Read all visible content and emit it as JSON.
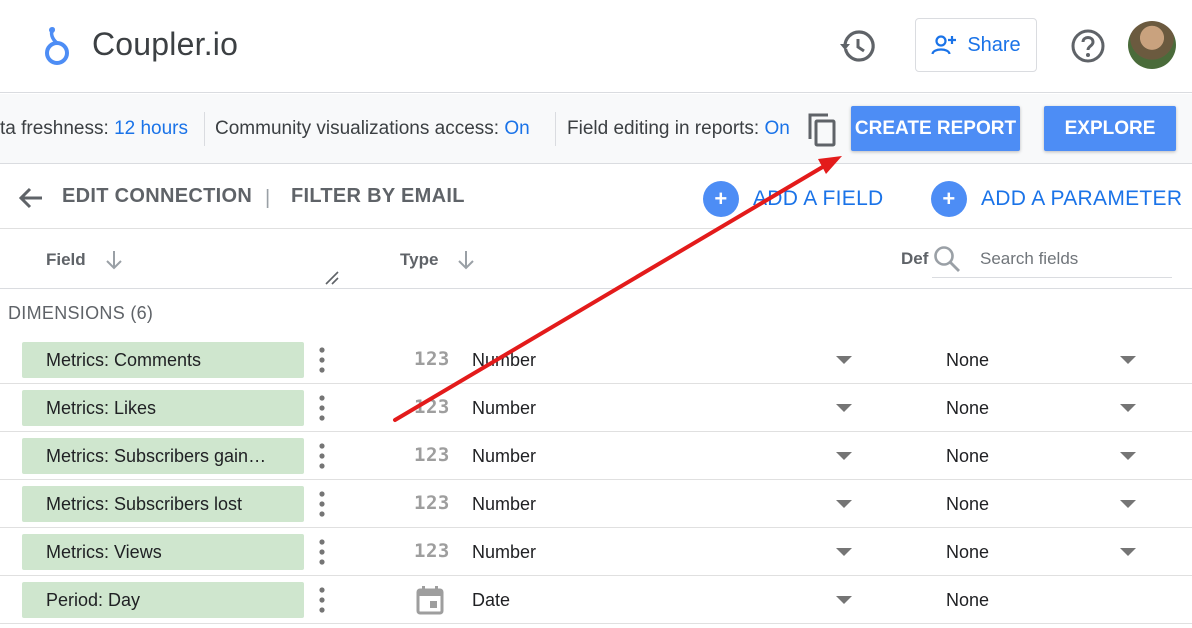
{
  "header": {
    "app_title": "Coupler.io",
    "share_label": "Share",
    "icons": {
      "logo": "coupler-logo",
      "history": "history-icon",
      "share": "person-add-icon",
      "help": "help-circle-icon",
      "avatar": "user-avatar"
    }
  },
  "infobar": {
    "freshness_label": "ta freshness: ",
    "freshness_value": "12 hours",
    "community_label": "Community visualizations access: ",
    "community_value": "On",
    "editing_label": "Field editing in reports: ",
    "editing_value": "On",
    "create_report_label": "CREATE REPORT",
    "explore_label": "EXPLORE"
  },
  "toolbar": {
    "edit_connection": "EDIT CONNECTION",
    "separator": "|",
    "filter_by_email": "FILTER BY EMAIL",
    "add_field": "ADD A FIELD",
    "add_parameter": "ADD A PARAMETER",
    "plus": "+"
  },
  "table": {
    "col_field": "Field",
    "col_type": "Type",
    "col_default": "Def",
    "search_placeholder": "Search fields",
    "section_title": "DIMENSIONS (6)",
    "rows": [
      {
        "name": "Metrics: Comments",
        "type_icon": "123",
        "type": "Number",
        "aggregation": "None"
      },
      {
        "name": "Metrics: Likes",
        "type_icon": "123",
        "type": "Number",
        "aggregation": "None"
      },
      {
        "name": "Metrics: Subscribers gain…",
        "type_icon": "123",
        "type": "Number",
        "aggregation": "None"
      },
      {
        "name": "Metrics: Subscribers lost",
        "type_icon": "123",
        "type": "Number",
        "aggregation": "None"
      },
      {
        "name": "Metrics: Views",
        "type_icon": "123",
        "type": "Number",
        "aggregation": "None"
      },
      {
        "name": "Period: Day",
        "type_icon": "calendar-icon",
        "type": "Date",
        "aggregation": "None"
      }
    ]
  },
  "colors": {
    "accent": "#1a73e8",
    "button": "#4d8df5",
    "chip": "#cfe6ce",
    "annotation_arrow": "#e31b1b"
  }
}
